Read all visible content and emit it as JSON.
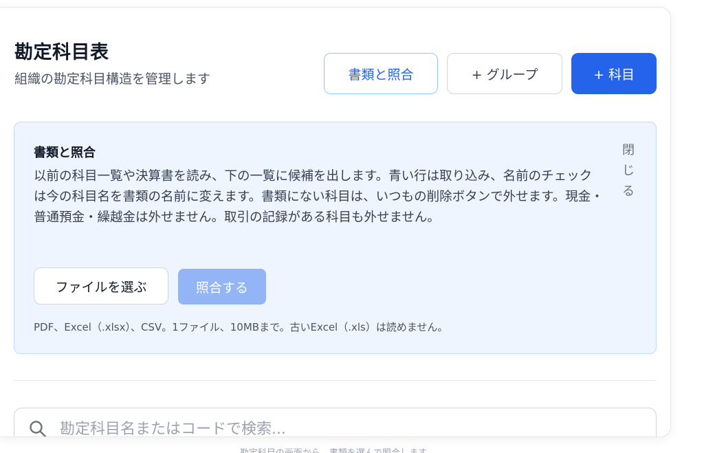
{
  "header": {
    "title": "勘定科目表",
    "subtitle": "組織の勘定科目構造を管理します"
  },
  "actions": {
    "match_label": "書類と照合",
    "add_group_label": "+ グループ",
    "add_account_label": "+ 科目"
  },
  "match_panel": {
    "title": "書類と照合",
    "close_label": "閉じる",
    "description": "以前の科目一覧や決算書を読み、下の一覧に候補を出します。青い行は取り込み、名前のチェックは今の科目名を書類の名前に変えます。書類にない科目は、いつもの削除ボタンで外せます。現金・普通預金・繰越金は外せません。取引の記録がある科目も外せません。",
    "choose_file_label": "ファイルを選ぶ",
    "run_match_label": "照合する",
    "file_note": "PDF、Excel（.xlsx）、CSV。1ファイル、10MBまで。古いExcel（.xls）は読めません。"
  },
  "search": {
    "placeholder": "勘定科目名またはコードで検索..."
  },
  "caption": "勘定科目の画面から、書類を選んで照合します",
  "colors": {
    "primary": "#2563eb",
    "primary_disabled": "#93b4f5",
    "panel_bg": "#eef5ff",
    "panel_border": "#bfdbfe"
  }
}
